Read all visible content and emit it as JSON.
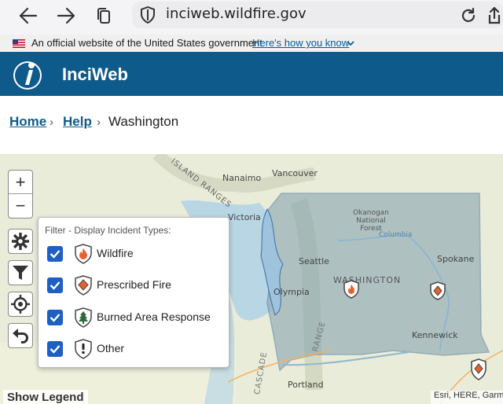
{
  "browser": {
    "url": "inciweb.wildfire.gov"
  },
  "gov_banner": {
    "text": "An official website of the United States government",
    "link": "Here's how you know"
  },
  "header": {
    "site_title": "InciWeb"
  },
  "breadcrumb": {
    "home": "Home",
    "help": "Help",
    "current": "Washington",
    "separator": "›"
  },
  "map": {
    "labels": {
      "nanaimo": "Nanaimo",
      "vancouver": "Vancouver",
      "island_ranges": "ISLAND RANGES",
      "victoria": "Victoria",
      "okanogan": "Okanogan National Forest",
      "columbia": "Columbia",
      "seattle": "Seattle",
      "spokane": "Spokane",
      "washington": "WASHINGTON",
      "olympia": "Olympia",
      "kennewick": "Kennewick",
      "portland": "Portland",
      "range": "RANGE",
      "cascade": "CASCADE"
    },
    "controls": {
      "zoom_in": "+",
      "zoom_out": "−"
    },
    "show_legend": "Show Legend",
    "attribution": "Esri, HERE, Garmin"
  },
  "filter": {
    "title": "Filter - Display Incident Types:",
    "items": [
      {
        "label": "Wildfire",
        "checked": true,
        "icon": "wildfire-icon"
      },
      {
        "label": "Prescribed Fire",
        "checked": true,
        "icon": "prescribed-fire-icon"
      },
      {
        "label": "Burned Area Response",
        "checked": true,
        "icon": "burned-area-icon"
      },
      {
        "label": "Other",
        "checked": true,
        "icon": "other-incident-icon"
      }
    ]
  },
  "colors": {
    "header_bg": "#0e5a8a",
    "link": "#0e5a8a",
    "checkbox": "#1d5fc3",
    "wildfire": "#e8612c",
    "state_fill": "#7f9fae"
  }
}
